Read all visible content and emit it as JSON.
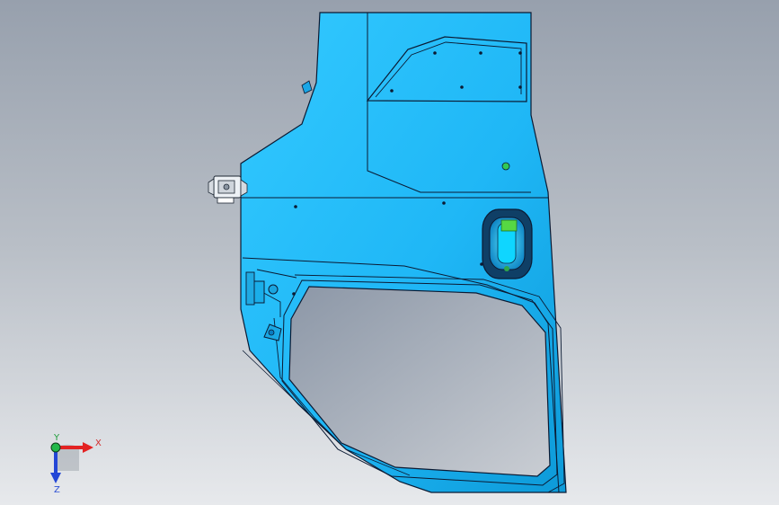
{
  "viewport": {
    "background_top": "#97a0ad",
    "background_bottom": "#e7e9ec",
    "model_color": "#1ec0ff",
    "model_shadow": "#0a8fc8",
    "edge_color": "#0b1a33"
  },
  "model": {
    "icons": {
      "hinge": "hinge-icon",
      "door_handle": "door-handle-icon",
      "window_cutout": "window-cutout-icon"
    }
  },
  "triad": {
    "x_label": "X",
    "y_label": "Y",
    "z_label": "Z",
    "x_color": "#e32222",
    "y_color": "#22b84a",
    "z_color": "#2346d6"
  }
}
